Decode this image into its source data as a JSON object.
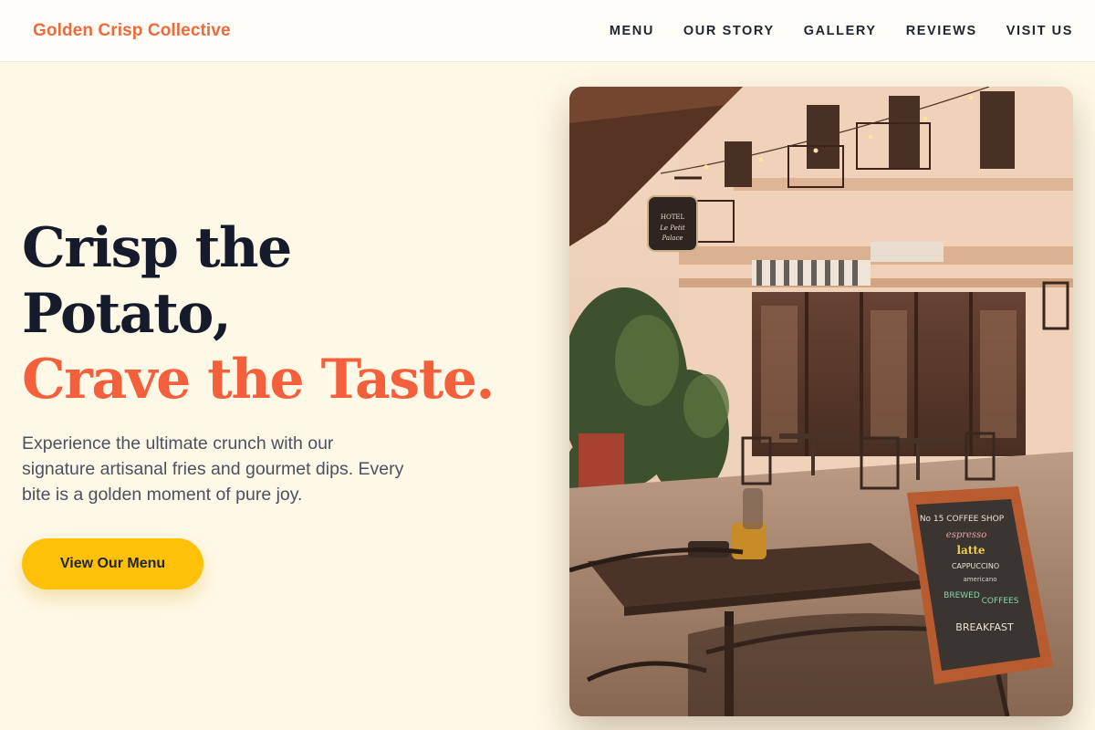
{
  "brand": {
    "name": "Golden Crisp Collective"
  },
  "nav": {
    "items": [
      "MENU",
      "OUR STORY",
      "GALLERY",
      "REVIEWS",
      "VISIT US"
    ]
  },
  "hero": {
    "headline_line1": "Crisp the",
    "headline_line2": "Potato,",
    "headline_accent": "Crave the Taste.",
    "subtext": "Experience the ultimate crunch with our signature artisanal fries and gourmet dips. Every bite is a golden moment of pure joy.",
    "cta_label": "View Our Menu"
  },
  "image": {
    "hotel_sign_line1": "HOTEL",
    "hotel_sign_line2": "Le Petit",
    "hotel_sign_line3": "Palace",
    "chalkboard_lines": [
      "No 15 COFFEE SHOP",
      "espresso",
      "latte",
      "CAPPUCCINO",
      "americano",
      "BREWED",
      "COFFEES",
      "BREAKFAST"
    ]
  },
  "colors": {
    "brand": "#EE6A3A",
    "accent": "#F4603C",
    "cta": "#FFC107",
    "background": "#FEF8E6",
    "heading": "#161B2C"
  }
}
